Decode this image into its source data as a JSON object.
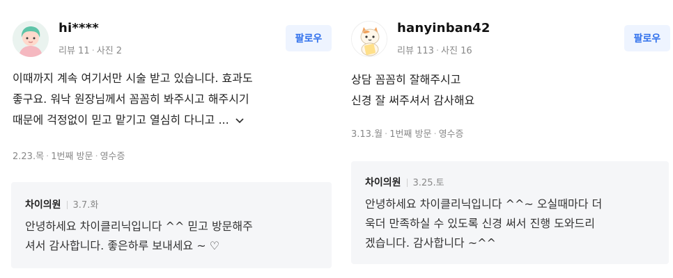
{
  "reviews": [
    {
      "username": "hi****",
      "review_label": "리뷰 11",
      "photo_label": "사진 2",
      "follow_label": "팔로우",
      "body": "이때까지 계속 여기서만 시술 받고 있습니다. 효과도\n좋구요. 워낙 원장님께서 꼼꼼히 봐주시고 해주시기\n때문에 걱정없이 믿고 맡기고 열심히 다니고 ...",
      "visit_date": "2.23.목",
      "visit_count": "1번째 방문",
      "receipt": "영수증",
      "reply": {
        "owner": "차이의원",
        "date": "3.7.화",
        "text": "안녕하세요 차이클리닉입니다 ^^ 믿고 방문해주\n셔서 감사합니다. 좋은하루 보내세요 ~ ♡"
      }
    },
    {
      "username": "hanyinban42",
      "review_label": "리뷰 113",
      "photo_label": "사진 16",
      "follow_label": "팔로우",
      "body": "상담 꼼꼼히 잘해주시고\n신경 잘 써주셔서 감사해요",
      "visit_date": "3.13.월",
      "visit_count": "1번째 방문",
      "receipt": "영수증",
      "reply": {
        "owner": "차이의원",
        "date": "3.25.토",
        "text": "안녕하세요 차이클리닉입니다 ^^~ 오실때마다 더\n욱더 만족하실 수 있도록 신경 써서 진행 도와드리\n겠습니다. 감사합니다 ~^^"
      }
    }
  ]
}
